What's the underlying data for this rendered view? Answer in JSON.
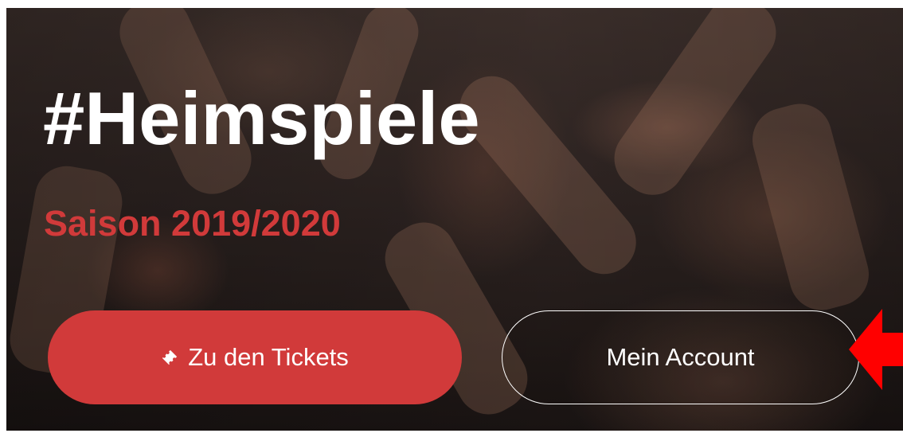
{
  "hero": {
    "title": "#Heimspiele",
    "subtitle": "Saison 2019/2020",
    "subtitle_color": "#d13a3a"
  },
  "buttons": {
    "tickets": {
      "label": "Zu den Tickets",
      "icon": "ticket-icon",
      "background": "#d13a3a"
    },
    "account": {
      "label": "Mein Account"
    }
  },
  "annotation": {
    "icon": "red-arrow-left-icon",
    "color": "#ff0000"
  }
}
